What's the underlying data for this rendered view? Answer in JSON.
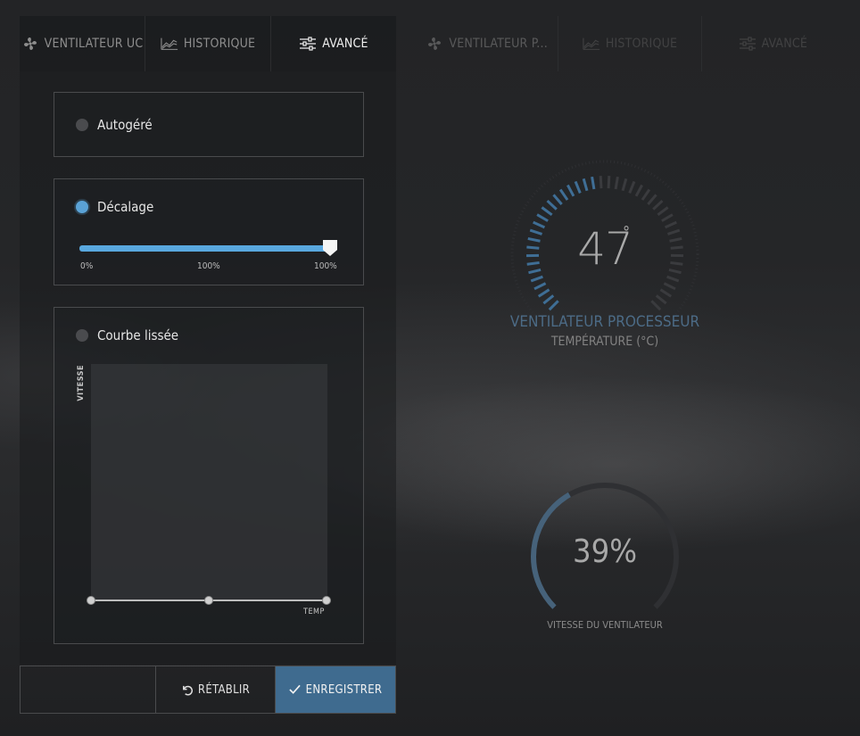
{
  "left_tabs": [
    {
      "label": "Ventilateur UC",
      "icon": "fan-icon",
      "active": false
    },
    {
      "label": "Historique",
      "icon": "chart-area-icon",
      "active": false
    },
    {
      "label": "Avancé",
      "icon": "sliders-icon",
      "active": true
    }
  ],
  "right_tabs": [
    {
      "label": "Ventilateur P...",
      "icon": "fan-icon"
    },
    {
      "label": "Historique",
      "icon": "chart-area-icon"
    },
    {
      "label": "Avancé",
      "icon": "sliders-icon"
    }
  ],
  "modes": {
    "auto": {
      "label": "Autogéré",
      "selected": false
    },
    "offset": {
      "label": "Décalage",
      "selected": true,
      "slider_value_percent": 100,
      "tick_min": "0%",
      "tick_mid": "100%",
      "tick_max": "100%"
    },
    "curve": {
      "label": "Courbe lissée",
      "selected": false,
      "y_axis_label": "VITESSE",
      "x_axis_label": "TEMP"
    }
  },
  "buttons": {
    "reset": "Rétablir",
    "save": "Enregistrer"
  },
  "temperature_gauge": {
    "value": "47",
    "unit_symbol": "°",
    "title": "Ventilateur processeur",
    "subtitle": "Température (°C)"
  },
  "fan_speed": {
    "value": "39%",
    "label": "Vitesse du ventilateur"
  },
  "colors": {
    "accent": "#5aa2d6",
    "save_button": "#3f6b8f",
    "gauge_title": "#4c6b86"
  }
}
